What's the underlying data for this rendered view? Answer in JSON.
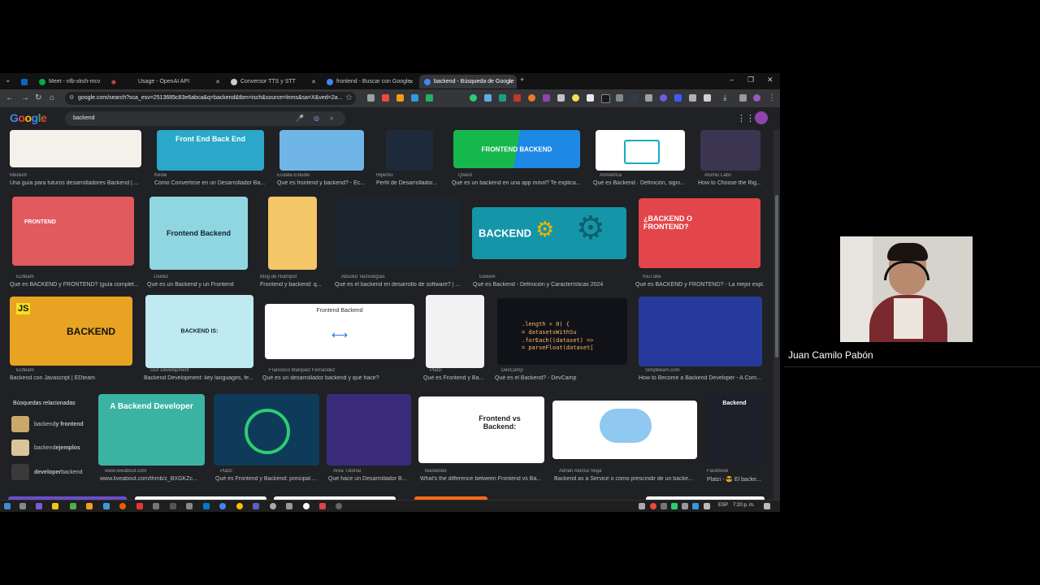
{
  "tabs": [
    {
      "label": "",
      "color": "#0a66c2"
    },
    {
      "label": "Meet - nfb-xksh-mcv",
      "color": "#00ac47"
    },
    {
      "label": "Usage - OpenAI API",
      "color": "#ffffff"
    },
    {
      "label": "Conversor TTS y STT",
      "color": "#d0d0d0"
    },
    {
      "label": "frontend - Buscar con Google",
      "color": "#4285f4"
    },
    {
      "label": "backend - Búsqueda de Google",
      "color": "#4285f4"
    }
  ],
  "address": "google.com/search?sca_esv=2513685c83e6abca&q=backend&tbm=isch&source=lnms&sa=X&ved=2a...",
  "google": {
    "logo": "Google",
    "query": "backend"
  },
  "row1": [
    {
      "source": "Medium",
      "title": "Una guía para futuros desarrolladores Backend | ...",
      "thumb_text": "",
      "bg": "#f4f1ea",
      "fg": "#333"
    },
    {
      "source": "Keola",
      "title": "Cómo Convertirse en un Desarrollador Ba...",
      "thumb_text": "Front End    Back End",
      "bg": "#2aa7c9",
      "fg": "#fff"
    },
    {
      "source": "Ecdata Estudio",
      "title": "Qué es frontend y backend? - Ec...",
      "thumb_text": "",
      "bg": "#6fb5e6",
      "fg": "#fff"
    },
    {
      "source": "Hipertio",
      "title": "Perfil de Desarrollador...",
      "thumb_text": "",
      "bg": "#1e2a3a",
      "fg": "#fff"
    },
    {
      "source": "Qwest",
      "title": "Qué es un backend en una app móvil? Te explica...",
      "thumb_text": "FRONTEND    BACKEND",
      "bg": "#16b84e",
      "fg": "#fff"
    },
    {
      "source": "Arimetrica",
      "title": "Qué es Backend · Definición, signi...",
      "thumb_text": "",
      "bg": "#ffffff",
      "fg": "#333"
    },
    {
      "source": "Atomic Labs",
      "title": "How to Choose the Rig...",
      "thumb_text": "",
      "bg": "#3b3552",
      "fg": "#fff"
    }
  ],
  "row2": [
    {
      "source": "EDteam",
      "title": "Qué es BACKEND y FRONTEND? (guía complet...",
      "thumb_text": "FRONTEND",
      "bg": "#e05a5e",
      "fg": "#fff"
    },
    {
      "source": "Usebiz",
      "title": "Qué es un Backend y un Frontend",
      "thumb_text": "Frontend  Backend",
      "bg": "#8fd6e0",
      "fg": "#123"
    },
    {
      "source": "Blog de HubSpot",
      "title": "Frontend y backend: q...",
      "thumb_text": "",
      "bg": "#f3c667",
      "fg": "#333"
    },
    {
      "source": "Absolut Tecnologías",
      "title": "Qué es el backend en desarrollo de software? | ...",
      "thumb_text": "",
      "bg": "#1b2530",
      "fg": "#9fd"
    },
    {
      "source": "Ekikem",
      "title": "Qué es Backend - Definición y Características 2024",
      "thumb_text": "BACKEND",
      "bg": "#1596a8",
      "fg": "#fff"
    },
    {
      "source": "YouTube",
      "title": "Qué es BACKEND y FRONTEND? - La mejor expl...",
      "thumb_text": "¿BACKEND O FRONTEND?",
      "bg": "#e2464b",
      "fg": "#fff"
    }
  ],
  "row3": [
    {
      "source": "EDteam",
      "title": "Backend con Javascript | EDteam",
      "thumb_text": "BACKEND",
      "bg": "#e9a322",
      "fg": "#111"
    },
    {
      "source": "GDI Development",
      "title": "Backend Development: key languages, fe...",
      "thumb_text": "BACKEND IS:",
      "bg": "#bfeaf1",
      "fg": "#123"
    },
    {
      "source": "Francisco Marquez Fernández",
      "title": "Qué es un desarrollador backend y qué hace?",
      "thumb_text": "Frontend        Backend",
      "bg": "#ffffff",
      "fg": "#333"
    },
    {
      "source": "Platzi",
      "title": "Qué es Frontend y Ba...",
      "thumb_text": "",
      "bg": "#f2f2f2",
      "fg": "#333"
    },
    {
      "source": "DevCamp",
      "title": "Qué es el Backend? - DevCamp",
      "thumb_text": "",
      "bg": "#111217",
      "fg": "#ffb86c"
    },
    {
      "source": "Simplilearn.com",
      "title": "How to Become a Backend Developer - A Com...",
      "thumb_text": "",
      "bg": "#263a9c",
      "fg": "#fff"
    }
  ],
  "related": {
    "title": "Búsquedas relacionadas",
    "items": [
      {
        "prefix": "backend ",
        "bold": "y frontend"
      },
      {
        "prefix": "backend ",
        "bold": "ejemplos"
      },
      {
        "prefix": "",
        "bold": "developer",
        "suffix": " backend"
      }
    ]
  },
  "row4": [
    {
      "source": "www.liveabout.com",
      "title": "www.liveabout.com/thmb/z_BXGKZc...",
      "thumb_text": "A Backend Developer",
      "bg": "#3bb3a3",
      "fg": "#fff"
    },
    {
      "source": "Platzi",
      "title": "Qué es Frontend y Backend: principal ...",
      "thumb_text": "",
      "bg": "#0e3b59",
      "fg": "#fff"
    },
    {
      "source": "Area Tutorial",
      "title": "Qué hace un Desarrollador B...",
      "thumb_text": "",
      "bg": "#3a2b7a",
      "fg": "#fff"
    },
    {
      "source": "Backendo",
      "title": "What's the difference between Frontend vs Ba...",
      "thumb_text": "Frontend vs Backend:",
      "bg": "#ffffff",
      "fg": "#222"
    },
    {
      "source": "Adrián Alonso Vega",
      "title": "Backend as a Service o cómo prescindir de un backe...",
      "thumb_text": "",
      "bg": "#ffffff",
      "fg": "#333"
    },
    {
      "source": "Facebook",
      "title": "Platzi - 😎 El backe...",
      "thumb_text": "Backend",
      "bg": "#1d1f2a",
      "fg": "#fff"
    }
  ],
  "taskbar": {
    "clock": "7:20 p. m.",
    "lang": "ESP"
  },
  "participant": {
    "name": "Juan Camilo Pabón"
  }
}
